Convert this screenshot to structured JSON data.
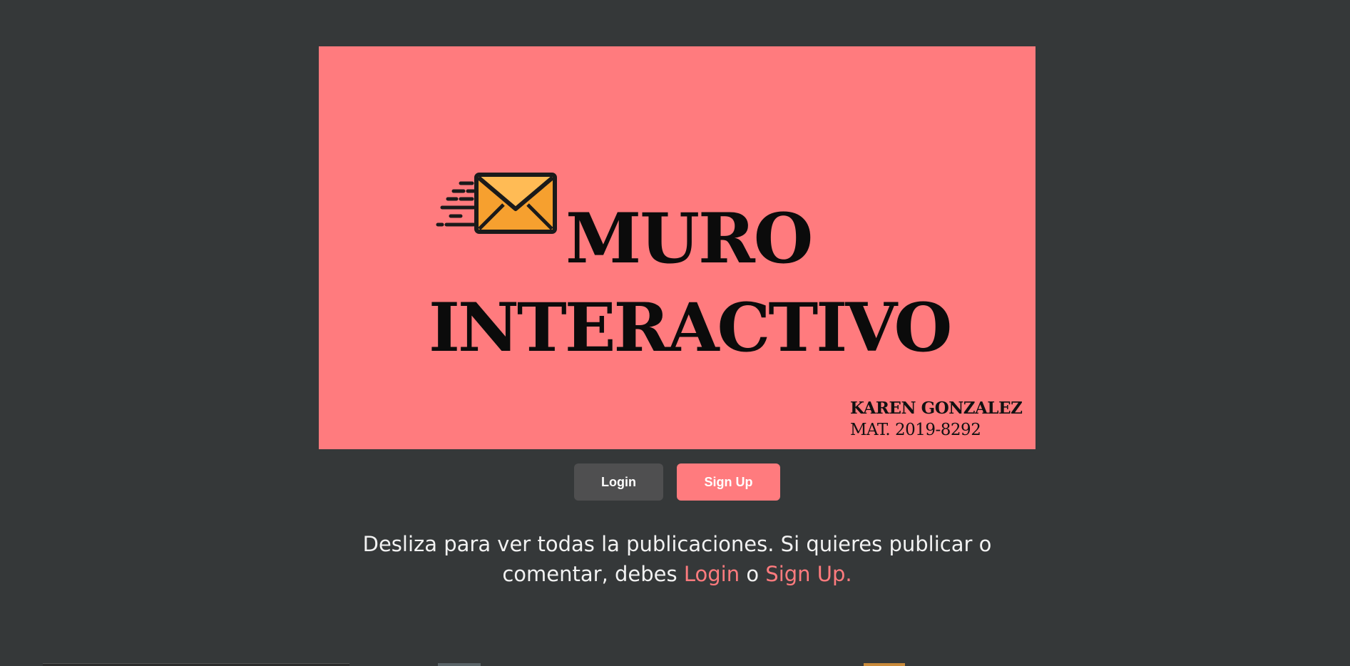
{
  "banner": {
    "title_line1": "MURO",
    "title_line2": "INTERACTIVO",
    "author_name": "KAREN GONZALEZ",
    "author_id": "MAT. 2019-8292",
    "icon": "envelope-icon",
    "background_color": "#ff7b7e"
  },
  "auth": {
    "login_label": "Login",
    "signup_label": "Sign Up",
    "login_color": "#4f4f50",
    "signup_color": "#ff7b7e"
  },
  "message": {
    "text_before": "Desliza para ver todas la publicaciones. Si quieres publicar o comentar, debes ",
    "login_link": "Login",
    "connector": " o ",
    "signup_link": "Sign Up."
  },
  "colors": {
    "page_background": "#353839",
    "accent": "#ff7b7e"
  }
}
